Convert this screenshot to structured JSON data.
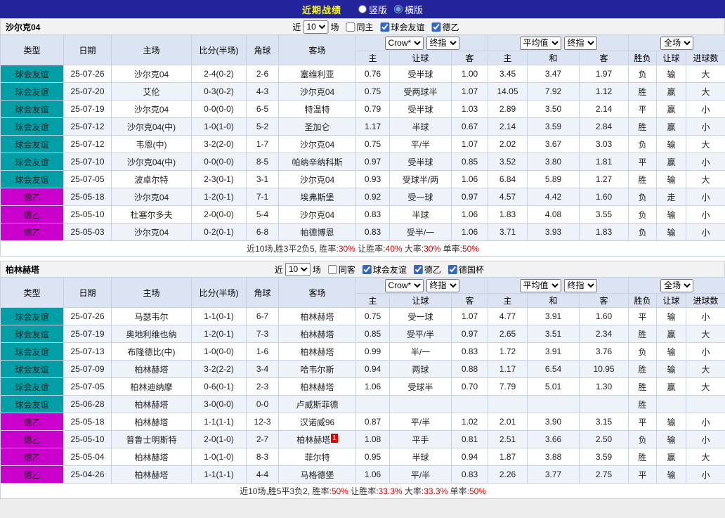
{
  "topbar": {
    "title": "近期战绩",
    "options": [
      {
        "label": "竖版",
        "selected": false
      },
      {
        "label": "横版",
        "selected": true
      }
    ]
  },
  "league_colors": {
    "球会友谊": "#00A0A6",
    "德乙": "#CC00CC"
  },
  "table": {
    "main_cols": [
      "类型",
      "日期",
      "主场",
      "比分(半场)",
      "角球",
      "客场"
    ],
    "odds_cols": [
      "主",
      "让球",
      "客"
    ],
    "avg_cols": [
      "主",
      "和",
      "客"
    ],
    "result_cols": [
      "胜负",
      "让球",
      "进球数"
    ],
    "controls": {
      "company": "Crow*",
      "company_period": "终指",
      "average": "平均值",
      "average_period": "终指",
      "scope": "全场"
    }
  },
  "sections": [
    {
      "team": "沙尔克04",
      "filter": {
        "prefix": "近",
        "count": "10",
        "suffix": "场",
        "checkboxes": [
          {
            "label": "同主",
            "checked": false
          },
          {
            "label": "球会友谊",
            "checked": true
          },
          {
            "label": "德乙",
            "checked": true
          }
        ]
      },
      "rows": [
        {
          "league": "球会友谊",
          "date": "25-07-26",
          "home": "沙尔克04",
          "hf": true,
          "score": "2-4(0-2)",
          "corner": "2-6",
          "away": "塞维利亚",
          "af": false,
          "o1": "0.76",
          "hcap": "受半球",
          "o2": "1.00",
          "a1": "3.45",
          "a2": "3.47",
          "a3": "1.97",
          "r": "负",
          "hr": "输",
          "gr": "大"
        },
        {
          "league": "球会友谊",
          "date": "25-07-20",
          "home": "艾伦",
          "hf": false,
          "score": "0-3(0-2)",
          "corner": "4-3",
          "away": "沙尔克04",
          "af": true,
          "o1": "0.75",
          "hcap": "受两球半",
          "o2": "1.07",
          "a1": "14.05",
          "a2": "7.92",
          "a3": "1.12",
          "r": "胜",
          "hr": "赢",
          "gr": "大"
        },
        {
          "league": "球会友谊",
          "date": "25-07-19",
          "home": "沙尔克04",
          "hf": true,
          "score": "0-0(0-0)",
          "corner": "6-5",
          "away": "特温特",
          "af": false,
          "o1": "0.79",
          "hcap": "受半球",
          "o2": "1.03",
          "a1": "2.89",
          "a2": "3.50",
          "a3": "2.14",
          "r": "平",
          "hr": "赢",
          "gr": "小"
        },
        {
          "league": "球会友谊",
          "date": "25-07-12",
          "home": "沙尔克04(中)",
          "hf": true,
          "score": "1-0(1-0)",
          "corner": "5-2",
          "away": "圣加仑",
          "af": false,
          "o1": "1.17",
          "hcap": "半球",
          "o2": "0.67",
          "a1": "2.14",
          "a2": "3.59",
          "a3": "2.84",
          "r": "胜",
          "hr": "赢",
          "gr": "小"
        },
        {
          "league": "球会友谊",
          "date": "25-07-12",
          "home": "韦恩(中)",
          "hf": false,
          "score": "3-2(2-0)",
          "corner": "1-7",
          "away": "沙尔克04",
          "af": true,
          "o1": "0.75",
          "hcap": "平/半",
          "o2": "1.07",
          "a1": "2.02",
          "a2": "3.67",
          "a3": "3.03",
          "r": "负",
          "hr": "输",
          "gr": "大"
        },
        {
          "league": "球会友谊",
          "date": "25-07-10",
          "home": "沙尔克04(中)",
          "hf": true,
          "score": "0-0(0-0)",
          "corner": "8-5",
          "away": "帕纳辛纳科斯",
          "af": false,
          "o1": "0.97",
          "hcap": "受半球",
          "o2": "0.85",
          "a1": "3.52",
          "a2": "3.80",
          "a3": "1.81",
          "r": "平",
          "hr": "赢",
          "gr": "小"
        },
        {
          "league": "球会友谊",
          "date": "25-07-05",
          "home": "波卓尔特",
          "hf": false,
          "score": "2-3(0-1)",
          "corner": "3-1",
          "away": "沙尔克04",
          "af": true,
          "o1": "0.93",
          "hcap": "受球半/两",
          "o2": "1.06",
          "a1": "6.84",
          "a2": "5.89",
          "a3": "1.27",
          "r": "胜",
          "hr": "输",
          "gr": "大"
        },
        {
          "league": "德乙",
          "date": "25-05-18",
          "home": "沙尔克04",
          "hf": true,
          "score": "1-2(0-1)",
          "corner": "7-1",
          "away": "埃弗斯堡",
          "af": false,
          "o1": "0.92",
          "hcap": "受一球",
          "o2": "0.97",
          "a1": "4.57",
          "a2": "4.42",
          "a3": "1.60",
          "r": "负",
          "hr": "走",
          "gr": "小"
        },
        {
          "league": "德乙",
          "date": "25-05-10",
          "home": "杜塞尔多夫",
          "hf": false,
          "score": "2-0(0-0)",
          "corner": "5-4",
          "away": "沙尔克04",
          "af": true,
          "o1": "0.83",
          "hcap": "半球",
          "o2": "1.06",
          "a1": "1.83",
          "a2": "4.08",
          "a3": "3.55",
          "r": "负",
          "hr": "输",
          "gr": "小"
        },
        {
          "league": "德乙",
          "date": "25-05-03",
          "home": "沙尔克04",
          "hf": true,
          "score": "0-2(0-1)",
          "corner": "6-8",
          "away": "帕德博恩",
          "af": false,
          "o1": "0.83",
          "hcap": "受半/一",
          "o2": "1.06",
          "a1": "3.71",
          "a2": "3.93",
          "a3": "1.83",
          "r": "负",
          "hr": "输",
          "gr": "小"
        }
      ],
      "summary": [
        {
          "t": "近10场,胜3平2负5, 胜率:"
        },
        {
          "t": "30%",
          "red": true
        },
        {
          "t": " 让胜率:"
        },
        {
          "t": "40%",
          "red": true
        },
        {
          "t": " 大率:"
        },
        {
          "t": "30%",
          "red": true
        },
        {
          "t": " 单率:"
        },
        {
          "t": "50%",
          "red": true
        }
      ]
    },
    {
      "team": "柏林赫塔",
      "filter": {
        "prefix": "近",
        "count": "10",
        "suffix": "场",
        "checkboxes": [
          {
            "label": "同客",
            "checked": false
          },
          {
            "label": "球会友谊",
            "checked": true
          },
          {
            "label": "德乙",
            "checked": true
          },
          {
            "label": "德国杯",
            "checked": true
          }
        ]
      },
      "rows": [
        {
          "league": "球会友谊",
          "date": "25-07-26",
          "home": "马瑟韦尔",
          "hf": false,
          "score": "1-1(0-1)",
          "corner": "6-7",
          "away": "柏林赫塔",
          "af": true,
          "o1": "0.75",
          "hcap": "受一球",
          "o2": "1.07",
          "a1": "4.77",
          "a2": "3.91",
          "a3": "1.60",
          "r": "平",
          "hr": "输",
          "gr": "小"
        },
        {
          "league": "球会友谊",
          "date": "25-07-19",
          "home": "奥地利维也纳",
          "hf": false,
          "score": "1-2(0-1)",
          "corner": "7-3",
          "away": "柏林赫塔",
          "af": true,
          "o1": "0.85",
          "hcap": "受平/半",
          "o2": "0.97",
          "a1": "2.65",
          "a2": "3.51",
          "a3": "2.34",
          "r": "胜",
          "hr": "赢",
          "gr": "大"
        },
        {
          "league": "球会友谊",
          "date": "25-07-13",
          "home": "布隆德比(中)",
          "hf": false,
          "score": "1-0(0-0)",
          "corner": "1-6",
          "away": "柏林赫塔",
          "af": true,
          "o1": "0.99",
          "hcap": "半/一",
          "o2": "0.83",
          "a1": "1.72",
          "a2": "3.91",
          "a3": "3.76",
          "r": "负",
          "hr": "输",
          "gr": "小"
        },
        {
          "league": "球会友谊",
          "date": "25-07-09",
          "home": "柏林赫塔",
          "hf": true,
          "score": "3-2(2-2)",
          "corner": "3-4",
          "away": "哈韦尔斯",
          "af": false,
          "o1": "0.94",
          "hcap": "两球",
          "o2": "0.88",
          "a1": "1.17",
          "a2": "6.54",
          "a3": "10.95",
          "r": "胜",
          "hr": "输",
          "gr": "大"
        },
        {
          "league": "球会友谊",
          "date": "25-07-05",
          "home": "柏林迪纳摩",
          "hf": false,
          "score": "0-6(0-1)",
          "corner": "2-3",
          "away": "柏林赫塔",
          "af": true,
          "o1": "1.06",
          "hcap": "受球半",
          "o2": "0.70",
          "a1": "7.79",
          "a2": "5.01",
          "a3": "1.30",
          "r": "胜",
          "hr": "赢",
          "gr": "大"
        },
        {
          "league": "球会友谊",
          "date": "25-06-28",
          "home": "柏林赫塔",
          "hf": true,
          "score": "3-0(0-0)",
          "corner": "0-0",
          "away": "卢威斯菲德",
          "af": false,
          "o1": "",
          "hcap": "",
          "o2": "",
          "a1": "",
          "a2": "",
          "a3": "",
          "r": "胜",
          "hr": "",
          "gr": ""
        },
        {
          "league": "德乙",
          "date": "25-05-18",
          "home": "柏林赫塔",
          "hf": true,
          "score": "1-1(1-1)",
          "corner": "12-3",
          "away": "汉诺威96",
          "af": false,
          "o1": "0.87",
          "hcap": "平/半",
          "o2": "1.02",
          "a1": "2.01",
          "a2": "3.90",
          "a3": "3.15",
          "r": "平",
          "hr": "输",
          "gr": "小"
        },
        {
          "league": "德乙",
          "date": "25-05-10",
          "home": "普鲁士明斯特",
          "hf": false,
          "score": "2-0(1-0)",
          "corner": "2-7",
          "away": "柏林赫塔",
          "af": true,
          "away_badge": "1",
          "o1": "1.08",
          "hcap": "平手",
          "o2": "0.81",
          "a1": "2.51",
          "a2": "3.66",
          "a3": "2.50",
          "r": "负",
          "hr": "输",
          "gr": "小"
        },
        {
          "league": "德乙",
          "date": "25-05-04",
          "home": "柏林赫塔",
          "hf": true,
          "score": "1-0(1-0)",
          "corner": "8-3",
          "away": "菲尔特",
          "af": false,
          "o1": "0.95",
          "hcap": "半球",
          "o2": "0.94",
          "a1": "1.87",
          "a2": "3.88",
          "a3": "3.59",
          "r": "胜",
          "hr": "赢",
          "gr": "大"
        },
        {
          "league": "德乙",
          "date": "25-04-26",
          "home": "柏林赫塔",
          "hf": true,
          "score": "1-1(1-1)",
          "corner": "4-4",
          "away": "马格德堡",
          "af": false,
          "o1": "1.06",
          "hcap": "平/半",
          "o2": "0.83",
          "a1": "2.26",
          "a2": "3.77",
          "a3": "2.75",
          "r": "平",
          "hr": "输",
          "gr": "小"
        }
      ],
      "summary": [
        {
          "t": "近10场,胜5平3负2, 胜率:"
        },
        {
          "t": "50%",
          "red": true
        },
        {
          "t": " 让胜率:"
        },
        {
          "t": "33.3%",
          "red": true
        },
        {
          "t": " 大率:"
        },
        {
          "t": "33.3%",
          "red": true
        },
        {
          "t": " 单率:"
        },
        {
          "t": "50%",
          "red": true
        }
      ]
    }
  ]
}
